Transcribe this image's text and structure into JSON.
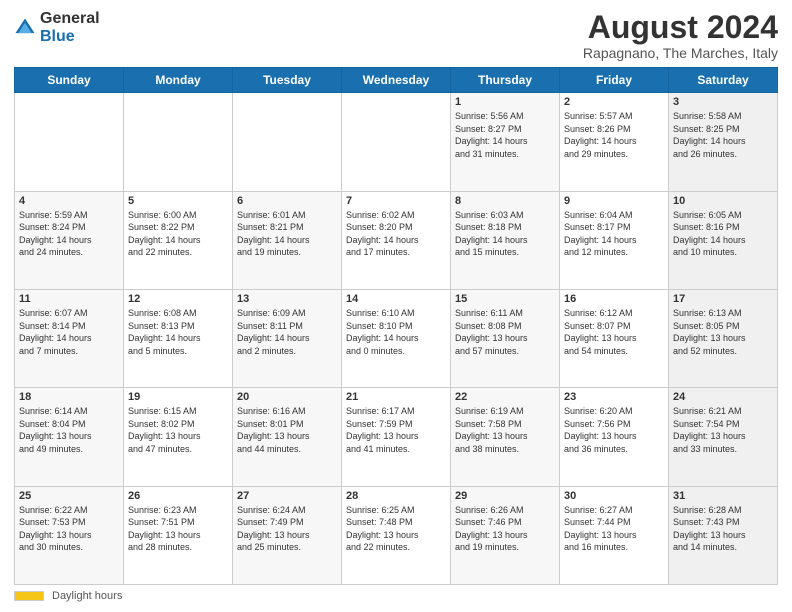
{
  "header": {
    "logo_general": "General",
    "logo_blue": "Blue",
    "month_title": "August 2024",
    "location": "Rapagnano, The Marches, Italy"
  },
  "weekdays": [
    "Sunday",
    "Monday",
    "Tuesday",
    "Wednesday",
    "Thursday",
    "Friday",
    "Saturday"
  ],
  "weeks": [
    [
      {
        "day": "",
        "info": ""
      },
      {
        "day": "",
        "info": ""
      },
      {
        "day": "",
        "info": ""
      },
      {
        "day": "",
        "info": ""
      },
      {
        "day": "1",
        "info": "Sunrise: 5:56 AM\nSunset: 8:27 PM\nDaylight: 14 hours\nand 31 minutes."
      },
      {
        "day": "2",
        "info": "Sunrise: 5:57 AM\nSunset: 8:26 PM\nDaylight: 14 hours\nand 29 minutes."
      },
      {
        "day": "3",
        "info": "Sunrise: 5:58 AM\nSunset: 8:25 PM\nDaylight: 14 hours\nand 26 minutes."
      }
    ],
    [
      {
        "day": "4",
        "info": "Sunrise: 5:59 AM\nSunset: 8:24 PM\nDaylight: 14 hours\nand 24 minutes."
      },
      {
        "day": "5",
        "info": "Sunrise: 6:00 AM\nSunset: 8:22 PM\nDaylight: 14 hours\nand 22 minutes."
      },
      {
        "day": "6",
        "info": "Sunrise: 6:01 AM\nSunset: 8:21 PM\nDaylight: 14 hours\nand 19 minutes."
      },
      {
        "day": "7",
        "info": "Sunrise: 6:02 AM\nSunset: 8:20 PM\nDaylight: 14 hours\nand 17 minutes."
      },
      {
        "day": "8",
        "info": "Sunrise: 6:03 AM\nSunset: 8:18 PM\nDaylight: 14 hours\nand 15 minutes."
      },
      {
        "day": "9",
        "info": "Sunrise: 6:04 AM\nSunset: 8:17 PM\nDaylight: 14 hours\nand 12 minutes."
      },
      {
        "day": "10",
        "info": "Sunrise: 6:05 AM\nSunset: 8:16 PM\nDaylight: 14 hours\nand 10 minutes."
      }
    ],
    [
      {
        "day": "11",
        "info": "Sunrise: 6:07 AM\nSunset: 8:14 PM\nDaylight: 14 hours\nand 7 minutes."
      },
      {
        "day": "12",
        "info": "Sunrise: 6:08 AM\nSunset: 8:13 PM\nDaylight: 14 hours\nand 5 minutes."
      },
      {
        "day": "13",
        "info": "Sunrise: 6:09 AM\nSunset: 8:11 PM\nDaylight: 14 hours\nand 2 minutes."
      },
      {
        "day": "14",
        "info": "Sunrise: 6:10 AM\nSunset: 8:10 PM\nDaylight: 14 hours\nand 0 minutes."
      },
      {
        "day": "15",
        "info": "Sunrise: 6:11 AM\nSunset: 8:08 PM\nDaylight: 13 hours\nand 57 minutes."
      },
      {
        "day": "16",
        "info": "Sunrise: 6:12 AM\nSunset: 8:07 PM\nDaylight: 13 hours\nand 54 minutes."
      },
      {
        "day": "17",
        "info": "Sunrise: 6:13 AM\nSunset: 8:05 PM\nDaylight: 13 hours\nand 52 minutes."
      }
    ],
    [
      {
        "day": "18",
        "info": "Sunrise: 6:14 AM\nSunset: 8:04 PM\nDaylight: 13 hours\nand 49 minutes."
      },
      {
        "day": "19",
        "info": "Sunrise: 6:15 AM\nSunset: 8:02 PM\nDaylight: 13 hours\nand 47 minutes."
      },
      {
        "day": "20",
        "info": "Sunrise: 6:16 AM\nSunset: 8:01 PM\nDaylight: 13 hours\nand 44 minutes."
      },
      {
        "day": "21",
        "info": "Sunrise: 6:17 AM\nSunset: 7:59 PM\nDaylight: 13 hours\nand 41 minutes."
      },
      {
        "day": "22",
        "info": "Sunrise: 6:19 AM\nSunset: 7:58 PM\nDaylight: 13 hours\nand 38 minutes."
      },
      {
        "day": "23",
        "info": "Sunrise: 6:20 AM\nSunset: 7:56 PM\nDaylight: 13 hours\nand 36 minutes."
      },
      {
        "day": "24",
        "info": "Sunrise: 6:21 AM\nSunset: 7:54 PM\nDaylight: 13 hours\nand 33 minutes."
      }
    ],
    [
      {
        "day": "25",
        "info": "Sunrise: 6:22 AM\nSunset: 7:53 PM\nDaylight: 13 hours\nand 30 minutes."
      },
      {
        "day": "26",
        "info": "Sunrise: 6:23 AM\nSunset: 7:51 PM\nDaylight: 13 hours\nand 28 minutes."
      },
      {
        "day": "27",
        "info": "Sunrise: 6:24 AM\nSunset: 7:49 PM\nDaylight: 13 hours\nand 25 minutes."
      },
      {
        "day": "28",
        "info": "Sunrise: 6:25 AM\nSunset: 7:48 PM\nDaylight: 13 hours\nand 22 minutes."
      },
      {
        "day": "29",
        "info": "Sunrise: 6:26 AM\nSunset: 7:46 PM\nDaylight: 13 hours\nand 19 minutes."
      },
      {
        "day": "30",
        "info": "Sunrise: 6:27 AM\nSunset: 7:44 PM\nDaylight: 13 hours\nand 16 minutes."
      },
      {
        "day": "31",
        "info": "Sunrise: 6:28 AM\nSunset: 7:43 PM\nDaylight: 13 hours\nand 14 minutes."
      }
    ]
  ],
  "footer": {
    "daylight_label": "Daylight hours"
  }
}
